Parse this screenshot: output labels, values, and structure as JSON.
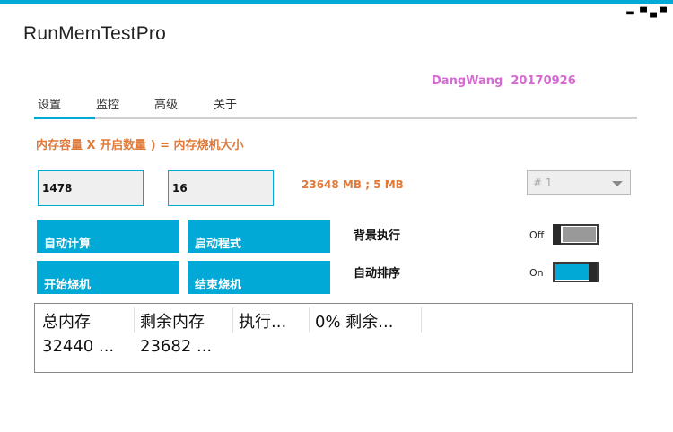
{
  "app": {
    "title": "RunMemTestPro",
    "author": "DangWang  20170926"
  },
  "window_controls": {
    "minimize": "▬",
    "maximize": "▀",
    "restore": "▄",
    "close": "▀"
  },
  "tabs": [
    {
      "label": "设置",
      "active": true
    },
    {
      "label": "监控",
      "active": false
    },
    {
      "label": "高级",
      "active": false
    },
    {
      "label": "关于",
      "active": false
    }
  ],
  "settings": {
    "formula": "内存容量 X 开启数量 ) = 内存烧机大小",
    "capacity_value": "1478",
    "count_value": "16",
    "result_text": "23648 MB ; 5 MB",
    "instance_select": "# 1"
  },
  "buttons": {
    "auto_calc": "自动计算",
    "start_program": "启动程式",
    "start_burn": "开始烧机",
    "stop_burn": "结束烧机"
  },
  "options": {
    "background_label": "背景执行",
    "background_state": "Off",
    "background_on": false,
    "autosort_label": "自动排序",
    "autosort_state": "On",
    "autosort_on": true
  },
  "table": {
    "headers": [
      "总内存",
      "剩余内存",
      "执行...",
      "0% 剩余..."
    ],
    "row": [
      "32440 ...",
      "23682 ..."
    ]
  },
  "colors": {
    "accent": "#00a9d6",
    "orange": "#e07a3a",
    "author_pink": "#d46ad2"
  }
}
